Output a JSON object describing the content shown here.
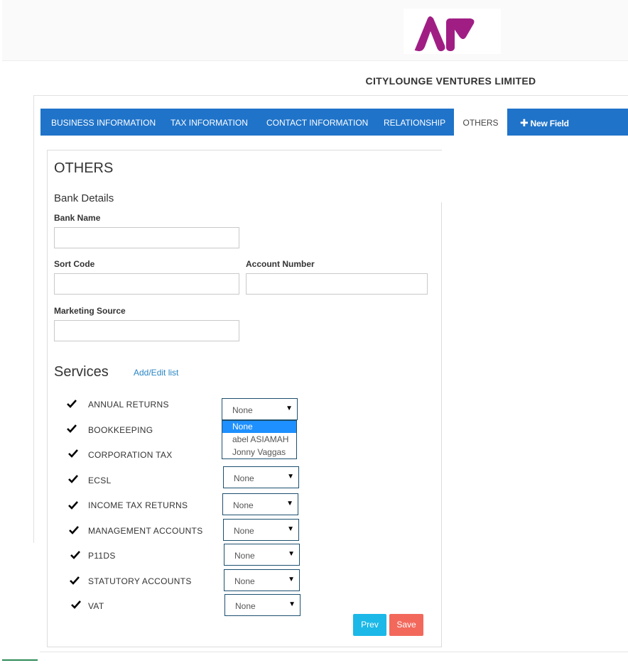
{
  "header": {
    "logo_text": "AP",
    "company_name": "CITYLOUNGE VENTURES LIMITED",
    "brand_color": "#a01e84"
  },
  "tabs": [
    {
      "label": "BUSINESS INFORMATION",
      "active": false
    },
    {
      "label": "TAX INFORMATION",
      "active": false
    },
    {
      "label": "CONTACT INFORMATION",
      "active": false
    },
    {
      "label": "RELATIONSHIP",
      "active": false
    },
    {
      "label": "OTHERS",
      "active": true
    }
  ],
  "new_field": {
    "icon": "plus-icon",
    "label": "New Field"
  },
  "section": {
    "title": "OTHERS"
  },
  "bank": {
    "heading": "Bank Details",
    "bank_name_label": "Bank Name",
    "bank_name_value": "",
    "sort_code_label": "Sort Code",
    "sort_code_value": "",
    "account_number_label": "Account Number",
    "account_number_value": "",
    "marketing_source_label": "Marketing Source",
    "marketing_source_value": ""
  },
  "services": {
    "heading": "Services",
    "add_edit_label": "Add/Edit list",
    "items": [
      {
        "label": "ANNUAL RETURNS",
        "checked": true,
        "assignee": "None"
      },
      {
        "label": "BOOKKEEPING",
        "checked": true,
        "assignee": null
      },
      {
        "label": "CORPORATION TAX",
        "checked": true,
        "assignee": null
      },
      {
        "label": "ECSL",
        "checked": true,
        "assignee": "None"
      },
      {
        "label": "INCOME TAX RETURNS",
        "checked": true,
        "assignee": "None"
      },
      {
        "label": "MANAGEMENT ACCOUNTS",
        "checked": true,
        "assignee": "None"
      },
      {
        "label": "P11DS",
        "checked": true,
        "assignee": "None"
      },
      {
        "label": "STATUTORY ACCOUNTS",
        "checked": true,
        "assignee": "None"
      },
      {
        "label": "VAT",
        "checked": true,
        "assignee": "None"
      }
    ],
    "dropdown_open": {
      "options": [
        "None",
        "abel ASIAMAH",
        "Jonny Vaggas"
      ],
      "selected": "None"
    }
  },
  "buttons": {
    "prev": "Prev",
    "save": "Save"
  },
  "colors": {
    "tabbar": "#1f73c9",
    "prev": "#1cb8e7",
    "save": "#f2695c",
    "link": "#2a86c4",
    "dropdown_highlight": "#1e90ff"
  }
}
